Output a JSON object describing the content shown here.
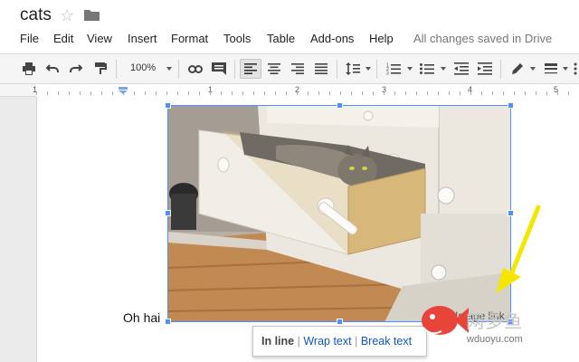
{
  "document": {
    "title": "cats",
    "save_status": "All changes saved in Drive",
    "body_text": "Oh hai",
    "image_link_text": "Image link"
  },
  "menu": [
    "File",
    "Edit",
    "View",
    "Insert",
    "Format",
    "Tools",
    "Table",
    "Add-ons",
    "Help"
  ],
  "toolbar": {
    "zoom": "100%",
    "icons": [
      "print-icon",
      "undo-icon",
      "redo-icon",
      "paint-format-icon",
      "link-icon",
      "comment-icon",
      "align-left-icon",
      "align-center-icon",
      "align-right-icon",
      "align-justify-icon",
      "line-spacing-icon",
      "numbered-list-icon",
      "bulleted-list-icon",
      "decrease-indent-icon",
      "increase-indent-icon",
      "pen-color-icon",
      "border-weight-icon"
    ]
  },
  "ruler": {
    "numbers": [
      "1",
      "1",
      "2",
      "3",
      "4",
      "5"
    ]
  },
  "image_options": {
    "in_line": "In line",
    "wrap_text": "Wrap text",
    "break_text": "Break text"
  },
  "watermark": {
    "text": "网多鱼",
    "url": "wduoyu.com"
  },
  "colors": {
    "selection": "#4d90fe",
    "link": "#1155cc",
    "arrow": "#f5e600",
    "watermark_fish": "#e8443a"
  }
}
